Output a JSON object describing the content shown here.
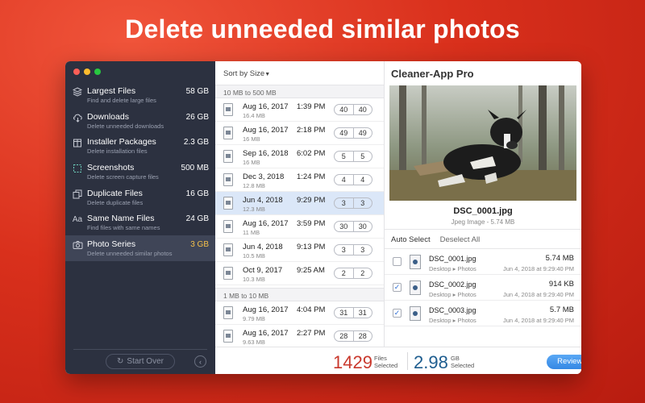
{
  "headline": "Delete unneeded similar photos",
  "sidebar": {
    "items": [
      {
        "title": "Largest Files",
        "subtitle": "Find and delete large files",
        "size": "58 GB",
        "icon": "stack-icon"
      },
      {
        "title": "Downloads",
        "subtitle": "Delete unneeded downloads",
        "size": "26 GB",
        "icon": "cloud-download-icon"
      },
      {
        "title": "Installer Packages",
        "subtitle": "Delete installation files",
        "size": "2.3 GB",
        "icon": "package-icon"
      },
      {
        "title": "Screenshots",
        "subtitle": "Delete screen capture files",
        "size": "500 MB",
        "icon": "screenshot-icon"
      },
      {
        "title": "Duplicate Files",
        "subtitle": "Delete duplicate files",
        "size": "16 GB",
        "icon": "duplicate-icon"
      },
      {
        "title": "Same Name Files",
        "subtitle": "Find files with same names",
        "size": "24 GB",
        "icon": "text-icon"
      },
      {
        "title": "Photo Series",
        "subtitle": "Delete unneeded similar photos",
        "size": "3 GB",
        "icon": "camera-icon"
      }
    ],
    "start_over": "Start Over"
  },
  "list": {
    "sort_label": "Sort by Size",
    "groups": [
      {
        "title": "10 MB to 500 MB",
        "rows": [
          {
            "date": "Aug 16, 2017",
            "size": "16.4 MB",
            "time": "1:39 PM",
            "a": "40",
            "b": "40"
          },
          {
            "date": "Aug 16, 2017",
            "size": "16 MB",
            "time": "2:18 PM",
            "a": "49",
            "b": "49"
          },
          {
            "date": "Sep 16, 2018",
            "size": "16 MB",
            "time": "6:02 PM",
            "a": "5",
            "b": "5"
          },
          {
            "date": "Dec 3, 2018",
            "size": "12.8 MB",
            "time": "1:24 PM",
            "a": "4",
            "b": "4"
          },
          {
            "date": "Jun 4, 2018",
            "size": "12.3 MB",
            "time": "9:29 PM",
            "a": "3",
            "b": "3"
          },
          {
            "date": "Aug 16, 2017",
            "size": "11 MB",
            "time": "3:59 PM",
            "a": "30",
            "b": "30"
          },
          {
            "date": "Jun 4, 2018",
            "size": "10.5 MB",
            "time": "9:13 PM",
            "a": "3",
            "b": "3"
          },
          {
            "date": "Oct 9, 2017",
            "size": "10.3 MB",
            "time": "9:25 AM",
            "a": "2",
            "b": "2"
          }
        ]
      },
      {
        "title": "1 MB to 10 MB",
        "rows": [
          {
            "date": "Aug 16, 2017",
            "size": "9.79 MB",
            "time": "4:04 PM",
            "a": "31",
            "b": "31"
          },
          {
            "date": "Aug 16, 2017",
            "size": "9.63 MB",
            "time": "2:27 PM",
            "a": "28",
            "b": "28"
          }
        ]
      }
    ]
  },
  "preview": {
    "app_title": "Cleaner-App Pro",
    "photo_name": "DSC_0001.jpg",
    "photo_meta": "Jpeg Image - 5.74 MB",
    "auto_select": "Auto Select",
    "deselect_all": "Deselect All",
    "files": [
      {
        "name": "DSC_0001.jpg",
        "path": "Desktop ▸ Photos",
        "size": "5.74 MB",
        "date": "Jun 4, 2018 at 9:29:40 PM",
        "checked": false
      },
      {
        "name": "DSC_0002.jpg",
        "path": "Desktop ▸ Photos",
        "size": "914 KB",
        "date": "Jun 4, 2018 at 9:29:40 PM",
        "checked": true
      },
      {
        "name": "DSC_0003.jpg",
        "path": "Desktop ▸ Photos",
        "size": "5.7 MB",
        "date": "Jun 4, 2018 at 9:29:40 PM",
        "checked": true
      }
    ]
  },
  "footer": {
    "files_count": "1429",
    "files_label_1": "Files",
    "files_label_2": "Selected",
    "gb_count": "2.98",
    "gb_label_1": "GB",
    "gb_label_2": "Selected",
    "review_button": "Review and Remove"
  },
  "colors": {
    "accent": "#3588e4",
    "files_count": "#c9382c",
    "gb_count": "#1e5d8f",
    "active_size": "#f5c04a"
  }
}
